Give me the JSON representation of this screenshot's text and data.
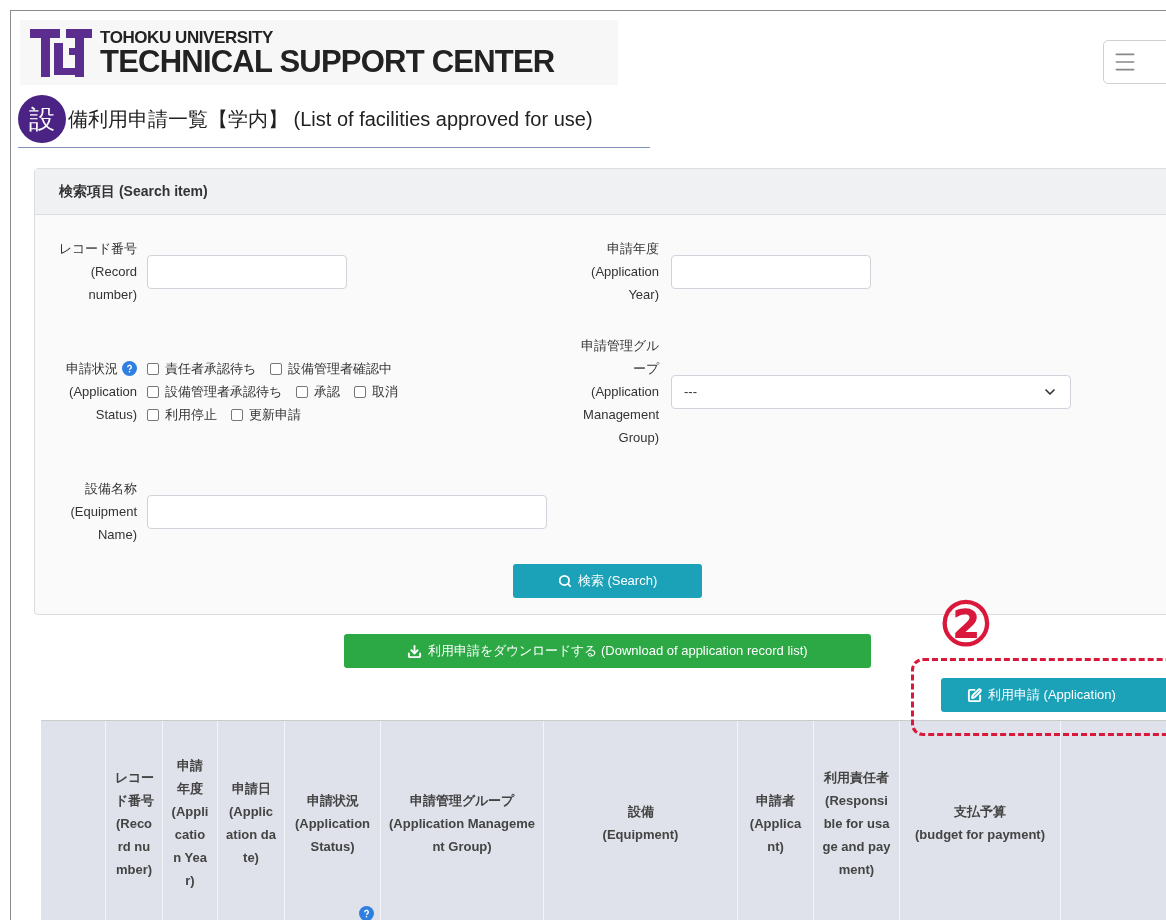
{
  "logo": {
    "line1": "TOHOKU UNIVERSITY",
    "line2": "TECHNICAL SUPPORT CENTER"
  },
  "page_title": {
    "badge": "設",
    "text": "備利用申請一覧【学内】 (List of facilities approved for use)"
  },
  "search_panel": {
    "title": "検索項目 (Search item)",
    "record_number": {
      "label": "レコード番号",
      "label_en": "(Record number)"
    },
    "application_year": {
      "label": "申請年度",
      "label_en": "(Application Year)"
    },
    "status": {
      "label": "申請状況",
      "label_en": "(Application Status)",
      "options": [
        {
          "label": "責任者承認待ち",
          "checked": false
        },
        {
          "label": "設備管理者確認中",
          "checked": false
        },
        {
          "label": "設備管理者承認待ち",
          "checked": false
        },
        {
          "label": "承認",
          "checked": false
        },
        {
          "label": "取消",
          "checked": false
        },
        {
          "label": "利用停止",
          "checked": false
        },
        {
          "label": "更新申請",
          "checked": false
        }
      ]
    },
    "management_group": {
      "label": "申請管理グループ",
      "label_en": "(Application Management Group)",
      "value": "---"
    },
    "equipment_name": {
      "label": "設備名称",
      "label_en": "(Equipment Name)"
    },
    "search_button": "検索 (Search)"
  },
  "download_button": "利用申請をダウンロードする (Download of application record list)",
  "annotation": {
    "marker": "②"
  },
  "application_button": "利用申請 (Application)",
  "table": {
    "columns": [
      {
        "ja": "レコード番号",
        "en": "(Record number)",
        "help": false
      },
      {
        "ja": "申請年度",
        "en": "(Application Year)",
        "help": false
      },
      {
        "ja": "申請日",
        "en": "(Application date)",
        "help": false
      },
      {
        "ja": "申請状況",
        "en": "(Application Status)",
        "help": true
      },
      {
        "ja": "申請管理グループ",
        "en": "(Application Management Group)",
        "help": false
      },
      {
        "ja": "設備",
        "en": "(Equipment)",
        "help": false
      },
      {
        "ja": "申請者",
        "en": "(Applicant)",
        "help": false
      },
      {
        "ja": "利用責任者",
        "en": "(Responsible for usage and payment)",
        "help": false
      },
      {
        "ja": "支払予算",
        "en": "(budget for payment)",
        "help": false
      }
    ]
  }
}
